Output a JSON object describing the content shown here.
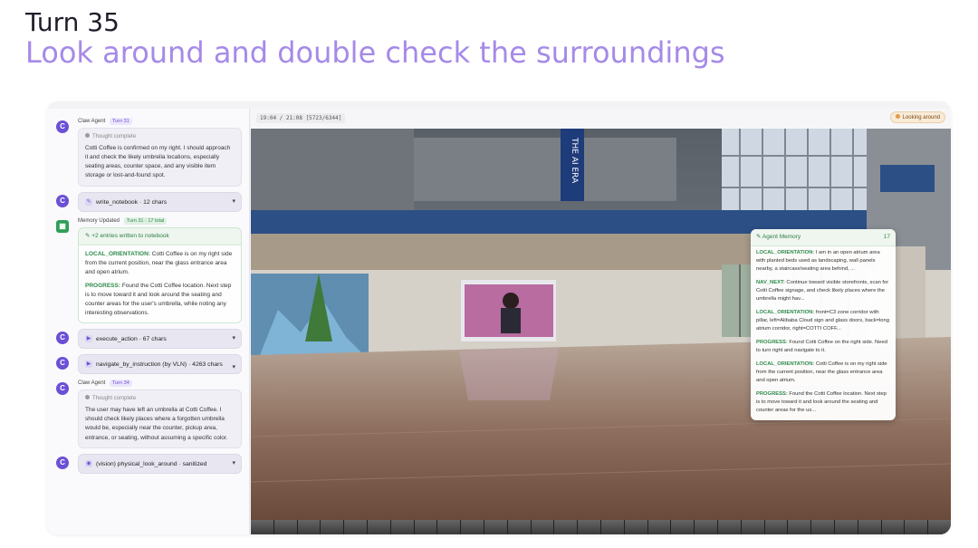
{
  "headline": {
    "turn": "Turn 35",
    "subtitle": "Look around and double check the surroundings"
  },
  "left_panel": {
    "entries": [
      {
        "kind": "agent",
        "agent": "Claw Agent",
        "turn": "Turn 31",
        "head": "Thought complete",
        "text": "Cotti Coffee is confirmed on my right. I should approach it and check the likely umbrella locations, especially seating areas, counter space, and any visible item storage or lost-and-found spot."
      },
      {
        "kind": "tool",
        "label": "write_notebook · 12 chars"
      },
      {
        "kind": "memory",
        "title": "Memory Updated",
        "turn": "Turn 31 · 17 total",
        "summary": "+2 entries written to notebook",
        "items": [
          {
            "key": "LOCAL_ORIENTATION:",
            "text": "Cotti Coffee is on my right side from the current position, near the glass entrance area and open atrium."
          },
          {
            "key": "PROGRESS:",
            "text": "Found the Cotti Coffee location. Next step is to move toward it and look around the seating and counter areas for the user's umbrella, while noting any interesting observations."
          }
        ]
      },
      {
        "kind": "tool",
        "label": "execute_action · 67 chars"
      },
      {
        "kind": "tool",
        "label": "navigate_by_instruction (by VLN) · 4263 chars"
      },
      {
        "kind": "agent",
        "agent": "Claw Agent",
        "turn": "Turn 34",
        "head": "Thought complete",
        "text": "The user may have left an umbrella at Cotti Coffee. I should check likely places where a forgotten umbrella would be, especially near the counter, pickup area, entrance, or seating, without assuming a specific color."
      },
      {
        "kind": "tool",
        "label": "(vision) physical_look_around · sanitized"
      }
    ]
  },
  "viewer": {
    "timecode": "19:04 / 21:08 [5723/6344]",
    "status": "Looking around",
    "signage": "THE AI ERA"
  },
  "memory_overlay": {
    "title": "Agent Memory",
    "count": "17",
    "entries": [
      {
        "key": "LOCAL_ORIENTATION:",
        "text": "I am in an open atrium area with planted beds used as landscaping, wall panels nearby, a staircase/seating area behind, ..."
      },
      {
        "key": "NAV_NEXT:",
        "text": "Continue toward visible storefronts, scan for Cotti Coffee signage, and check likely places where the umbrella might hav..."
      },
      {
        "key": "LOCAL_ORIENTATION:",
        "text": "front=C3 zone corridor with pillar, left=Alibaba Cloud sign and glass doors, back=long atrium corridor, right=COTTI COFF..."
      },
      {
        "key": "PROGRESS:",
        "text": "Found Cotti Coffee on the right side. Need to turn right and navigate to it."
      },
      {
        "key": "LOCAL_ORIENTATION:",
        "text": "Cotti Coffee is on my right side from the current position, near the glass entrance area and open atrium."
      },
      {
        "key": "PROGRESS:",
        "text": "Found the Cotti Coffee location. Next step is to move toward it and look around the seating and counter areas for the us..."
      }
    ]
  },
  "colors": {
    "accent": "#a68ae8",
    "agent": "#6b4fd6",
    "memory": "#2f8a4c",
    "status": "#e39b4c"
  }
}
